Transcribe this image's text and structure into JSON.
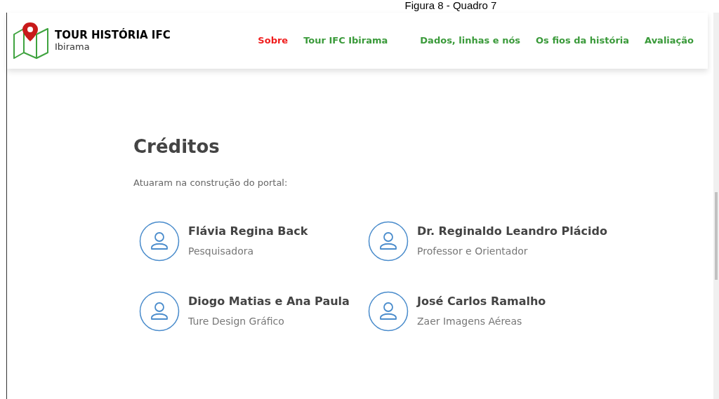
{
  "caption": "Figura 8 - Quadro 7",
  "header": {
    "brand": {
      "title": "TOUR HISTÓRIA IFC",
      "subtitle": "Ibirama"
    },
    "nav": [
      {
        "label": "Sobre",
        "selected": true
      },
      {
        "label": "Tour IFC Ibirama",
        "selected": false
      },
      {
        "label": "Dados, linhas e nós",
        "selected": false
      },
      {
        "label": "Os fios da história",
        "selected": false
      },
      {
        "label": "Avaliação",
        "selected": false
      }
    ]
  },
  "credits": {
    "title": "Créditos",
    "intro": "Atuaram na construção do portal:",
    "people": [
      {
        "name": "Flávia Regina Back",
        "role": "Pesquisadora"
      },
      {
        "name": "Dr. Reginaldo Leandro Plácido",
        "role": "Professor e Orientador"
      },
      {
        "name": "Diogo Matias e Ana Paula",
        "role": "Ture Design Gráfico"
      },
      {
        "name": "José Carlos Ramalho",
        "role": "Zaer Imagens Aéreas"
      }
    ]
  }
}
